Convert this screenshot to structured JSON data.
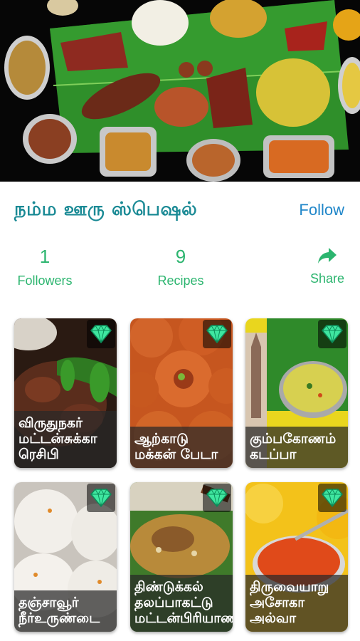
{
  "profile": {
    "title": "நம்ம ஊரு ஸ்பெஷல்",
    "follow_label": "Follow"
  },
  "stats": {
    "followers_count": "1",
    "followers_label": "Followers",
    "recipes_count": "9",
    "recipes_label": "Recipes",
    "share_label": "Share"
  },
  "recipes": [
    {
      "title": "விருதுநகர் மட்டன்சுக்கா ரெசிபி"
    },
    {
      "title": "ஆற்காடு மக்கன் பேடா"
    },
    {
      "title": "கும்பகோணம் கடப்பா"
    },
    {
      "title": "தஞ்சாவூர் நீர்உருண்டை"
    },
    {
      "title": "திண்டுக்கல் தலப்பாகட்டு மட்டன்பிரியாணி"
    },
    {
      "title": "திருவையாறு அசோகா அல்வா"
    }
  ],
  "icons": {
    "premium": "diamond-icon",
    "share": "share-arrow-icon"
  },
  "colors": {
    "title": "#1a8a95",
    "follow": "#1f86c9",
    "stats": "#2cb56f",
    "premium_gem": "#3fe6a0"
  }
}
